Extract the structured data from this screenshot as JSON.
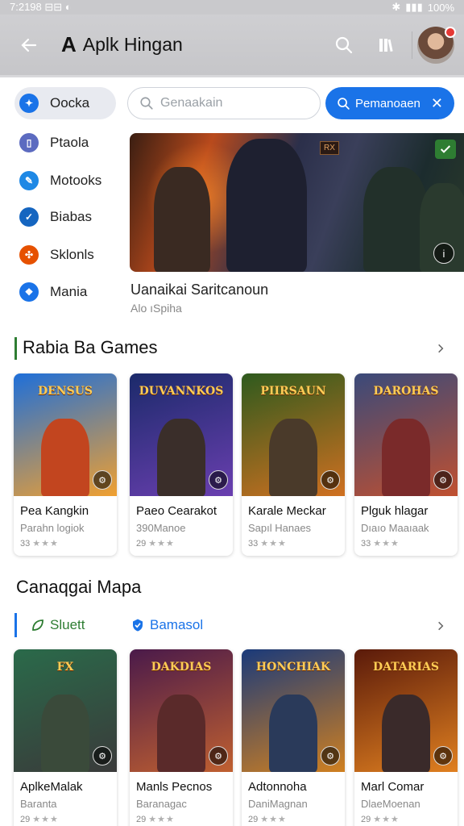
{
  "status_bar": {
    "time": "7:2198",
    "left_icons": "⊟⊟ ◐",
    "right": "100%"
  },
  "app_bar": {
    "title": "Aplk Hingan",
    "logo": "A"
  },
  "sidebar": {
    "items": [
      {
        "label": "Oocka",
        "color": "#1a73e8",
        "glyph": "✦",
        "active": true
      },
      {
        "label": "Ptaola",
        "color": "#5c6bc0",
        "glyph": "▯",
        "active": false
      },
      {
        "label": "Motooks",
        "color": "#1e88e5",
        "glyph": "✎",
        "active": false
      },
      {
        "label": "Biabas",
        "color": "#1565c0",
        "glyph": "✓",
        "active": false
      },
      {
        "label": "Sklonls",
        "color": "#e65100",
        "glyph": "✣",
        "active": false
      },
      {
        "label": "Mania",
        "color": "#1a73e8",
        "glyph": "❖",
        "active": false
      }
    ]
  },
  "search": {
    "placeholder": "Genaakain"
  },
  "filter_chip": {
    "label": "Pemanoaen"
  },
  "hero": {
    "title": "Uanaikai Saritcanoun",
    "subtitle": "Alo ıSpiha",
    "tag": "RX"
  },
  "section1": {
    "title": "Rabia Ba Games",
    "cards": [
      {
        "name": "Pea Kangkin",
        "dev": "Parahn logiok",
        "rating": "33",
        "art_title": "DENSUS",
        "bg": [
          "#1e6fd9",
          "#f0a030"
        ],
        "fig": "#c2451f"
      },
      {
        "name": "Paeo Cearakot",
        "dev": "390Manoe",
        "rating": "29",
        "art_title": "DUVANNKOS",
        "bg": [
          "#1b2a6a",
          "#6a3fb0"
        ],
        "fig": "#3a2e2a"
      },
      {
        "name": "Karale Meckar",
        "dev": "Sapıl Hanaes",
        "rating": "33",
        "art_title": "PIIRSAUN",
        "bg": [
          "#2e5a1e",
          "#d07020"
        ],
        "fig": "#4a3a2a"
      },
      {
        "name": "Plguk hlagar",
        "dev": "Dıaıo Maaıaak",
        "rating": "33",
        "art_title": "DAROHAS",
        "bg": [
          "#3a4a7a",
          "#c05030"
        ],
        "fig": "#7a2a2a"
      }
    ]
  },
  "section2": {
    "title": "Canaqgai Mapa",
    "filters": [
      {
        "label": "Sluett",
        "color": "#2e7d32"
      },
      {
        "label": "Bamasol",
        "color": "#1a73e8"
      }
    ],
    "cards": [
      {
        "name": "AplkeMalak",
        "dev": "Baranta",
        "rating": "29",
        "art_title": "FX",
        "bg": [
          "#2a6a4a",
          "#3a3a3a"
        ],
        "fig": "#3a4a3a"
      },
      {
        "name": "Manls Pecnos",
        "dev": "Baranagac",
        "rating": "29",
        "art_title": "DAKDIAS",
        "bg": [
          "#4a1a4a",
          "#c06030"
        ],
        "fig": "#5a2a2a"
      },
      {
        "name": "Adtonnoha",
        "dev": "DaniMagnan",
        "rating": "29",
        "art_title": "HONCHIAK",
        "bg": [
          "#1a3a7a",
          "#d08020"
        ],
        "fig": "#2a3a5a"
      },
      {
        "name": "Marl Comar",
        "dev": "DlaeMoenan",
        "rating": "29",
        "art_title": "DATARIAS",
        "bg": [
          "#5a1a0a",
          "#e08020"
        ],
        "fig": "#3a2a2a"
      }
    ]
  }
}
